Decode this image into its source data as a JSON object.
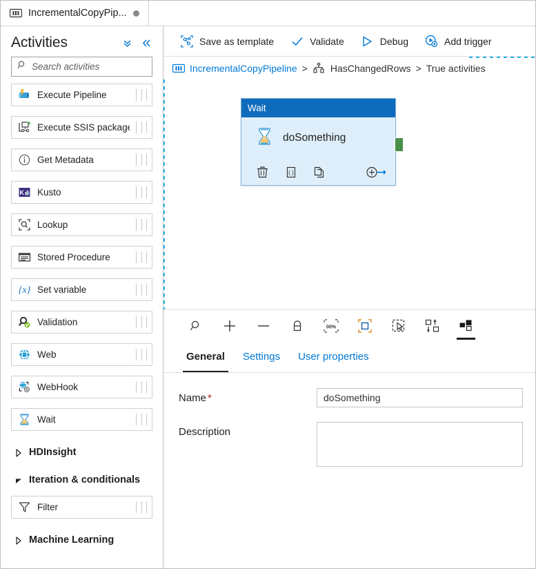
{
  "tab": {
    "title": "IncrementalCopyPip...",
    "icon": "pipeline-icon",
    "modified_dot": true
  },
  "left_panel": {
    "title": "Activities",
    "collapse_all_icon": "double-chevron-down-icon",
    "collapse_panel_icon": "double-chevron-left-icon",
    "search": {
      "placeholder": "Search activities",
      "value": "",
      "icon": "search-icon"
    },
    "items": [
      {
        "label": "Execute Pipeline",
        "icon": "execute-pipeline-icon",
        "type": "activity"
      },
      {
        "label": "Execute SSIS package",
        "icon": "execute-ssis-icon",
        "type": "activity"
      },
      {
        "label": "Get Metadata",
        "icon": "get-metadata-icon",
        "type": "activity"
      },
      {
        "label": "Kusto",
        "icon": "kusto-icon",
        "type": "activity"
      },
      {
        "label": "Lookup",
        "icon": "lookup-icon",
        "type": "activity"
      },
      {
        "label": "Stored Procedure",
        "icon": "stored-procedure-icon",
        "type": "activity"
      },
      {
        "label": "Set variable",
        "icon": "set-variable-icon",
        "type": "activity"
      },
      {
        "label": "Validation",
        "icon": "validation-icon",
        "type": "activity"
      },
      {
        "label": "Web",
        "icon": "web-icon",
        "type": "activity"
      },
      {
        "label": "WebHook",
        "icon": "webhook-icon",
        "type": "activity"
      },
      {
        "label": "Wait",
        "icon": "wait-icon",
        "type": "activity"
      },
      {
        "label": "HDInsight",
        "icon": "chevron-right-icon",
        "type": "group",
        "expanded": false
      },
      {
        "label": "Iteration & conditionals",
        "icon": "chevron-down-icon",
        "type": "group",
        "expanded": true
      },
      {
        "label": "Filter",
        "icon": "filter-icon",
        "type": "activity"
      },
      {
        "label": "Machine Learning",
        "icon": "chevron-right-icon",
        "type": "group",
        "expanded": false
      }
    ]
  },
  "command_bar": {
    "buttons": [
      {
        "label": "Save as template",
        "icon": "save-as-template-icon"
      },
      {
        "label": "Validate",
        "icon": "checkmark-icon"
      },
      {
        "label": "Debug",
        "icon": "play-triangle-icon"
      },
      {
        "label": "Add trigger",
        "icon": "add-trigger-icon"
      }
    ]
  },
  "breadcrumb": {
    "pipeline_icon": "pipeline-icon",
    "pipeline_label": "IncrementalCopyPipeline",
    "separator_1": ">",
    "activity_icon": "if-condition-icon",
    "activity_label": "HasChangedRows",
    "separator_2": ">",
    "branch_label": "True activities"
  },
  "canvas": {
    "node": {
      "type_label": "Wait",
      "name": "doSomething",
      "icon": "hourglass-icon",
      "header_color": "#0f6cbd",
      "body_color": "#deeffb",
      "border_color": "#7fb2d9",
      "output_handle_color": "#4a8f4a",
      "footer_icons": [
        {
          "name": "delete-icon"
        },
        {
          "name": "code-braces-icon"
        },
        {
          "name": "copy-icon"
        }
      ],
      "add_output_icon": "add-output-arrow-icon"
    },
    "tools": [
      {
        "name": "zoom-icon",
        "active": false
      },
      {
        "name": "zoom-in-icon",
        "active": false
      },
      {
        "name": "zoom-out-icon",
        "active": false
      },
      {
        "name": "lock-icon",
        "active": false
      },
      {
        "name": "zoom-100-percent-icon",
        "active": false,
        "text": "00%"
      },
      {
        "name": "fit-to-screen-icon",
        "active": false
      },
      {
        "name": "selection-tool-icon",
        "active": false
      },
      {
        "name": "auto-align-icon",
        "active": false
      },
      {
        "name": "layout-icon",
        "active": true
      }
    ]
  },
  "properties": {
    "tabs": [
      {
        "label": "General",
        "active": true
      },
      {
        "label": "Settings",
        "active": false
      },
      {
        "label": "User properties",
        "active": false
      }
    ],
    "fields": {
      "name_label": "Name",
      "name_required": "*",
      "name_value": "doSomething",
      "description_label": "Description",
      "description_value": ""
    }
  },
  "colors": {
    "accent_blue": "#0078d4",
    "link_blue": "#0078d4",
    "node_header": "#0f6cbd",
    "required_red": "#a4262c",
    "dashed_cyan": "#23b0e8",
    "green_handle": "#4a8f4a"
  }
}
